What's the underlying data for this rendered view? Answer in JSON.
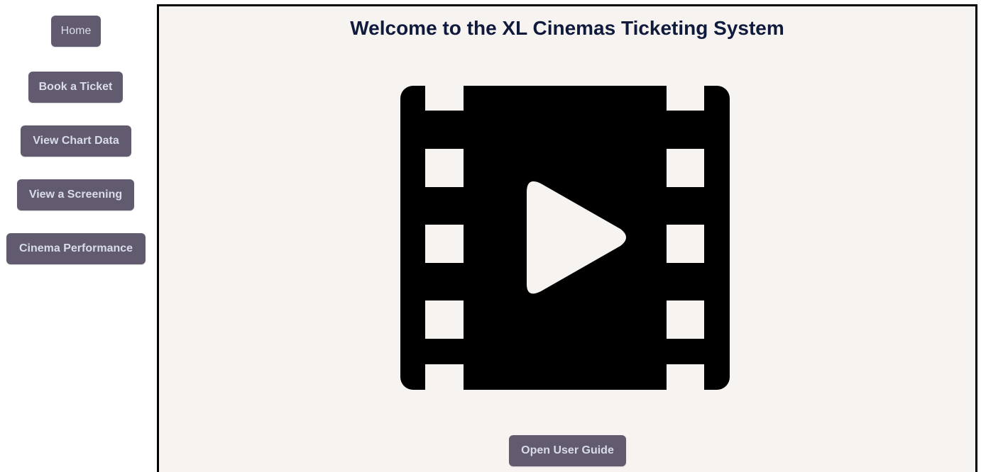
{
  "sidebar": {
    "items": [
      {
        "label": "Home"
      },
      {
        "label": "Book a Ticket"
      },
      {
        "label": "View Chart Data"
      },
      {
        "label": "View a Screening"
      },
      {
        "label": "Cinema Performance"
      }
    ]
  },
  "main": {
    "title": "Welcome to the XL Cinemas Ticketing System",
    "hero_icon": "film-play-icon",
    "guide_button_label": "Open User Guide"
  },
  "colors": {
    "button_bg": "#625a6e",
    "button_text": "#d9dde8",
    "panel_bg": "#f6f3f0",
    "title_text": "#0f1a3c",
    "icon": "#000000"
  }
}
